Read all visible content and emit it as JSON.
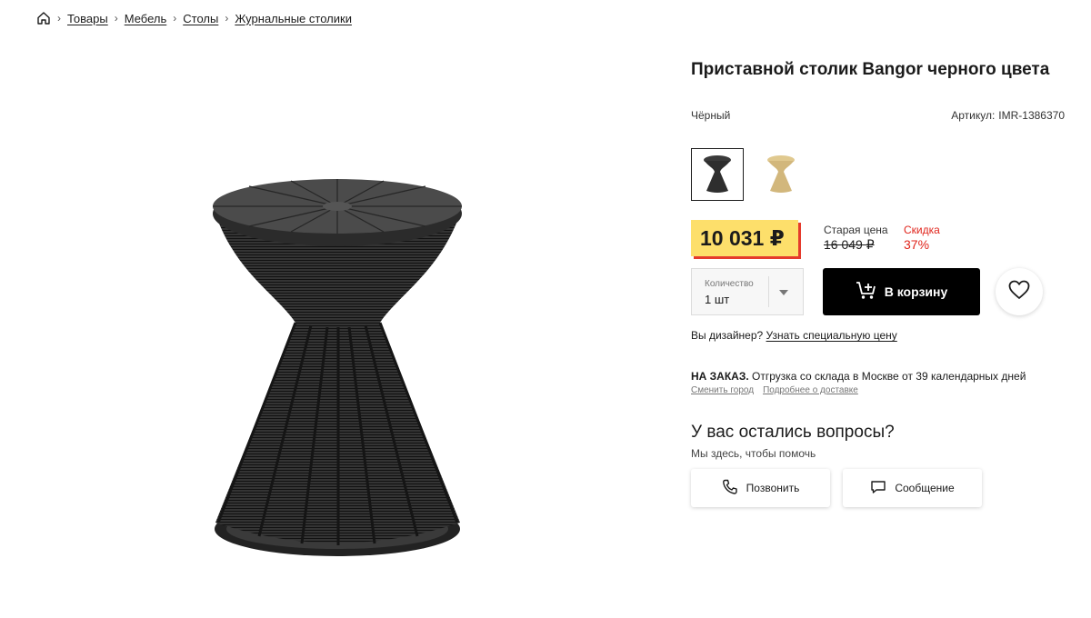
{
  "breadcrumb": {
    "items": [
      "Товары",
      "Мебель",
      "Столы",
      "Журнальные столики"
    ]
  },
  "product": {
    "title": "Приставной столик Bangor черного цвета",
    "color_name": "Чёрный",
    "article_label": "Артикул:",
    "article_value": "IMR-1386370"
  },
  "swatches": [
    {
      "label": "black",
      "color": "#2e2e2e",
      "selected": true
    },
    {
      "label": "gold",
      "color": "#d2b77c",
      "selected": false
    }
  ],
  "price": {
    "current": "10 031 ₽",
    "old_label": "Старая цена",
    "old_value": "16 049 ₽",
    "discount_label": "Скидка",
    "discount_value": "37%"
  },
  "quantity": {
    "label": "Количество",
    "value": "1 шт"
  },
  "actions": {
    "cart_label": "В корзину"
  },
  "designer": {
    "text": "Вы дизайнер?",
    "link": "Узнать специальную цену"
  },
  "delivery": {
    "status": "НА ЗАКАЗ.",
    "text": "Отгрузка со склада в Москве от 39 календарных дней",
    "change_city": "Сменить город",
    "more": "Подробнее о доставке"
  },
  "questions": {
    "title": "У вас остались вопросы?",
    "subtitle": "Мы здесь, чтобы помочь",
    "call_label": "Позвонить",
    "message_label": "Сообщение"
  },
  "colors": {
    "price_badge": "#fddf6b",
    "accent_red": "#e0241b",
    "cart_button": "#000000"
  }
}
